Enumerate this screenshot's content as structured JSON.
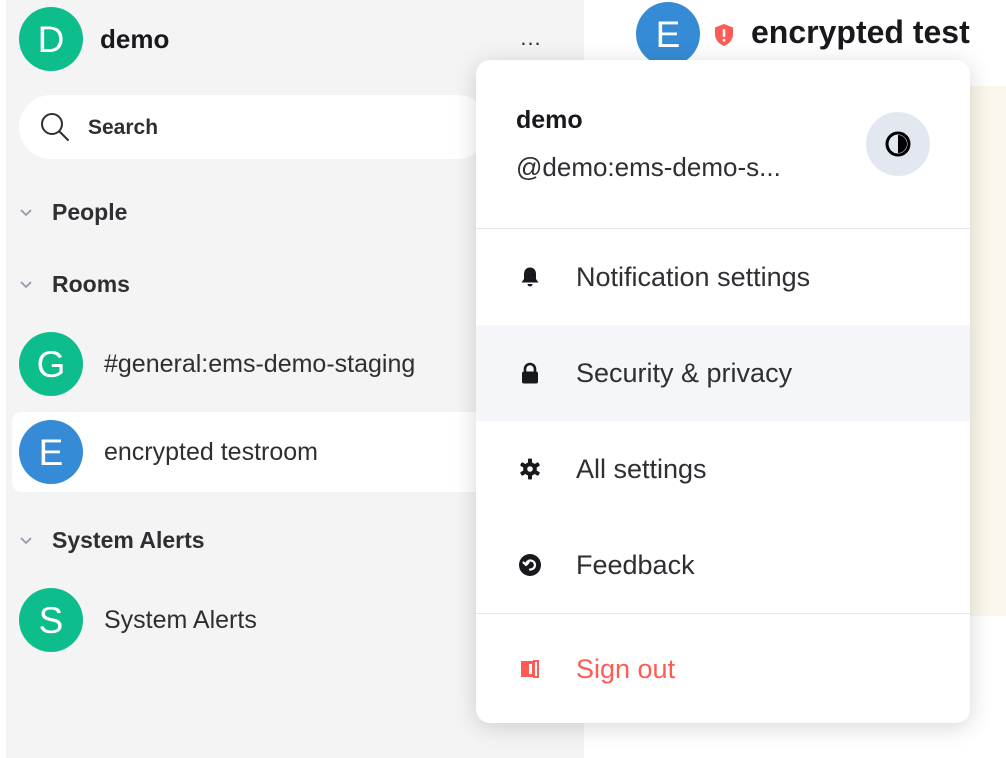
{
  "colors": {
    "avatar_green": "#0dbd8b",
    "avatar_blue": "#368bd6",
    "danger": "#ff5b55",
    "shield_red": "#ff5b55",
    "sidebar_bg": "#f4f4f4"
  },
  "user_header": {
    "avatar_letter": "D",
    "name": "demo",
    "options_label": "..."
  },
  "search": {
    "icon": "search-icon",
    "placeholder": "Search"
  },
  "sections": {
    "people": {
      "label": "People",
      "icon": "chevron-down-icon"
    },
    "rooms": {
      "label": "Rooms",
      "icon": "chevron-down-icon"
    },
    "system_alerts": {
      "label": "System Alerts",
      "icon": "chevron-down-icon"
    }
  },
  "rooms": [
    {
      "avatar_letter": "G",
      "name": "#general:ems-demo-staging",
      "avatar_color": "#0dbd8b",
      "selected": false
    },
    {
      "avatar_letter": "E",
      "name": "encrypted testroom",
      "avatar_color": "#368bd6",
      "selected": true
    }
  ],
  "system_alert_rooms": [
    {
      "avatar_letter": "S",
      "name": "System Alerts",
      "avatar_color": "#0dbd8b"
    }
  ],
  "main_header": {
    "avatar_letter": "E",
    "title": "encrypted test",
    "shield_icon": "shield-icon"
  },
  "menu": {
    "user_name": "demo",
    "user_id": "@demo:ems-demo-s...",
    "theme_icon": "theme-toggle-icon",
    "items": [
      {
        "label": "Notification settings",
        "icon": "bell-icon"
      },
      {
        "label": "Security & privacy",
        "icon": "lock-icon"
      },
      {
        "label": "All settings",
        "icon": "gear-icon"
      },
      {
        "label": "Feedback",
        "icon": "feedback-icon"
      }
    ],
    "sign_out": {
      "label": "Sign out",
      "icon": "sign-out-icon"
    }
  }
}
